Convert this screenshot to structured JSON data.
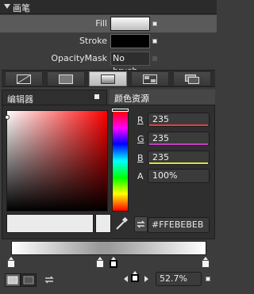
{
  "panel": {
    "title": "画笔"
  },
  "properties": [
    {
      "label": "Fill",
      "value": ""
    },
    {
      "label": "Stroke",
      "value": ""
    },
    {
      "label": "OpacityMask",
      "value": "No brush"
    }
  ],
  "toolbar": {
    "buttons": [
      {
        "icon": "no-brush-icon"
      },
      {
        "icon": "solid-brush-icon"
      },
      {
        "icon": "gradient-brush-icon"
      },
      {
        "icon": "tile-brush-icon"
      },
      {
        "icon": "resource-brush-icon"
      }
    ],
    "active_index": 2
  },
  "tabs": [
    {
      "label": "编辑器"
    },
    {
      "label": "颜色资源"
    }
  ],
  "channels": [
    {
      "key": "R",
      "value": "235",
      "bar_color": "#e04040"
    },
    {
      "key": "G",
      "value": "235",
      "bar_color": "#c040c0"
    },
    {
      "key": "B",
      "value": "235",
      "bar_color": "#e0e040"
    },
    {
      "key": "A",
      "value": "100%",
      "bar_color": ""
    }
  ],
  "hex": {
    "value": "#FFEBEBEB"
  },
  "gradient": {
    "offset": "52.7%",
    "stops": [
      {
        "color": "#ffffff",
        "selected": false
      },
      {
        "color": "#9a9a9a",
        "selected": false
      },
      {
        "color": "#ebebeb",
        "selected": true
      },
      {
        "color": "#ffffff",
        "selected": false
      }
    ]
  },
  "colors": {
    "current": "#ebebeb",
    "accent": "#e8e8e8"
  }
}
